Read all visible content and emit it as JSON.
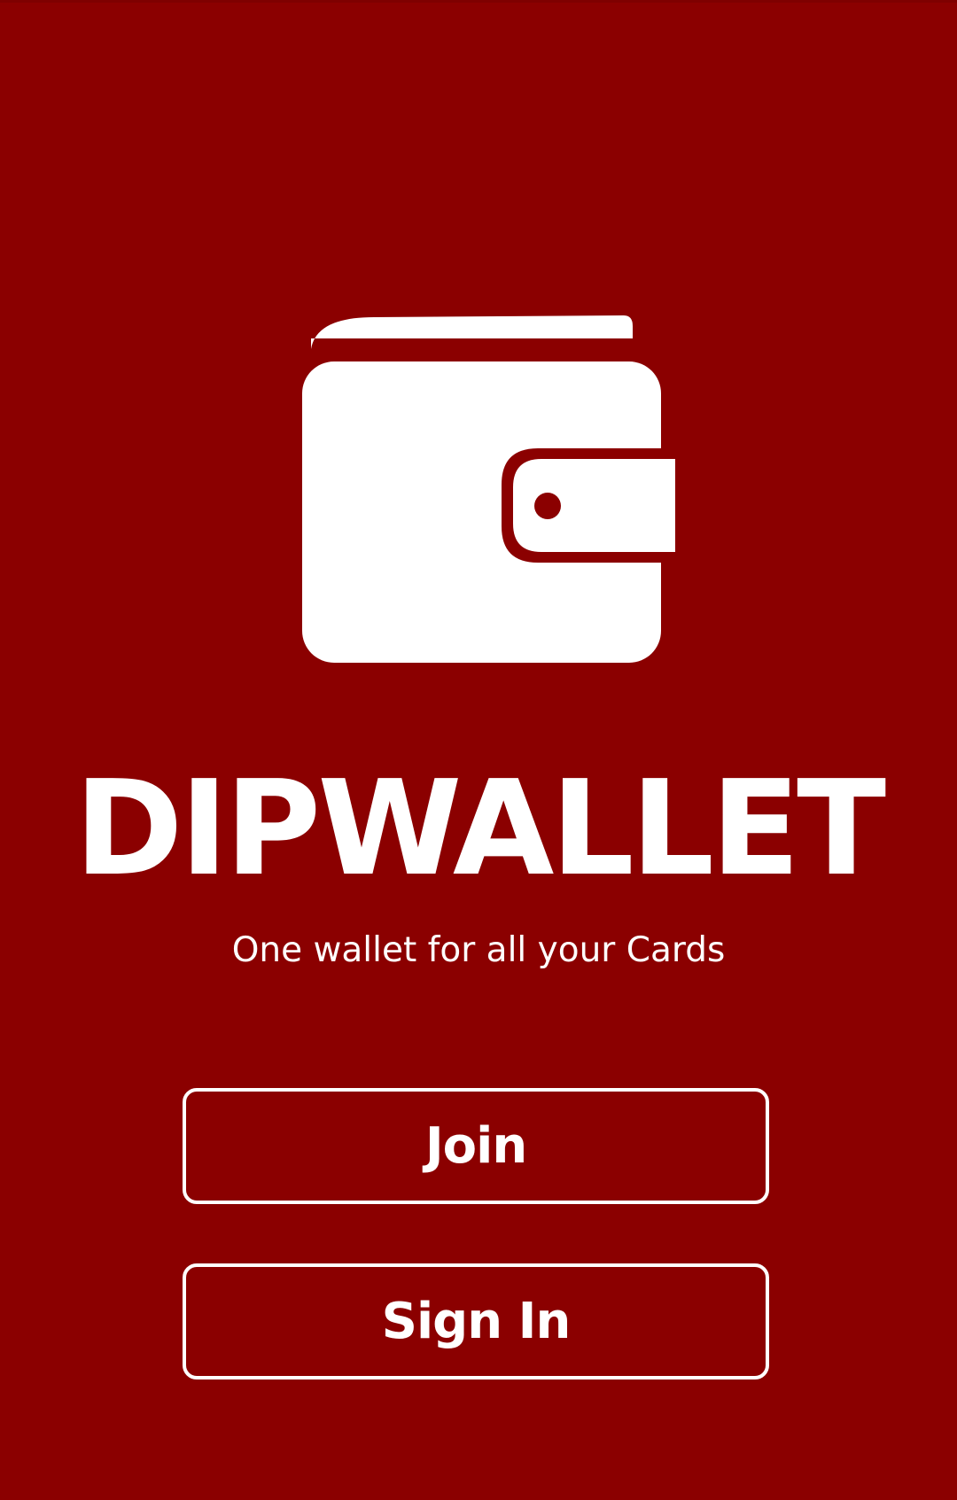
{
  "app": {
    "title": "DIPWALLET",
    "tagline": "One wallet for all your Cards",
    "logo_icon": "wallet-icon"
  },
  "actions": {
    "join_label": "Join",
    "signin_label": "Sign In"
  },
  "colors": {
    "background": "#8b0000",
    "foreground": "#ffffff"
  }
}
